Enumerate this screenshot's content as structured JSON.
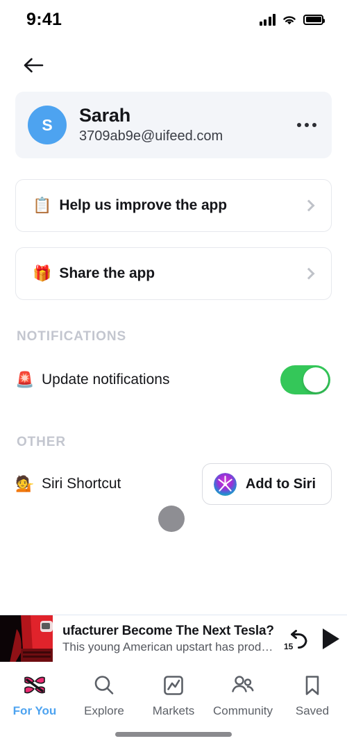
{
  "status_bar": {
    "time": "9:41",
    "signal_icon": "cellular-bars-icon",
    "wifi_icon": "wifi-icon",
    "battery_icon": "battery-full-icon"
  },
  "navbar": {
    "back_icon": "back-arrow-icon"
  },
  "profile": {
    "avatar_initial": "S",
    "avatar_color": "#4da3f0",
    "name": "Sarah",
    "email": "3709ab9e@uifeed.com",
    "more_icon": "ellipsis-icon"
  },
  "links": [
    {
      "emoji": "📋",
      "icon_name": "clipboard-icon",
      "label": "Help us improve the app",
      "chevron": "chevron-right-icon"
    },
    {
      "emoji": "🎁",
      "icon_name": "gift-icon",
      "label": "Share the app",
      "chevron": "chevron-right-icon"
    }
  ],
  "notifications": {
    "section_title": "NOTIFICATIONS",
    "row": {
      "emoji": "🚨",
      "icon_name": "siren-icon",
      "label": "Update notifications",
      "toggle_on": true,
      "toggle_color": "#34c759"
    }
  },
  "other": {
    "section_title": "OTHER",
    "row": {
      "emoji": "💁",
      "icon_name": "person-tipping-hand-icon",
      "label": "Siri Shortcut",
      "button_label": "Add to Siri",
      "button_icon": "siri-orb-icon"
    }
  },
  "player": {
    "thumbnail": "red-car-thumbnail",
    "title": "ufacturer Become The Next Tesla?",
    "subtitle": "This young American upstart has produ...",
    "rewind_seconds": "15",
    "rewind_icon": "rewind-15-icon",
    "play_icon": "play-icon"
  },
  "tabs": [
    {
      "label": "For You",
      "icon": "pinwheel-icon",
      "active": true
    },
    {
      "label": "Explore",
      "icon": "search-icon",
      "active": false
    },
    {
      "label": "Markets",
      "icon": "chart-icon",
      "active": false
    },
    {
      "label": "Community",
      "icon": "people-icon",
      "active": false
    },
    {
      "label": "Saved",
      "icon": "bookmark-icon",
      "active": false
    }
  ]
}
